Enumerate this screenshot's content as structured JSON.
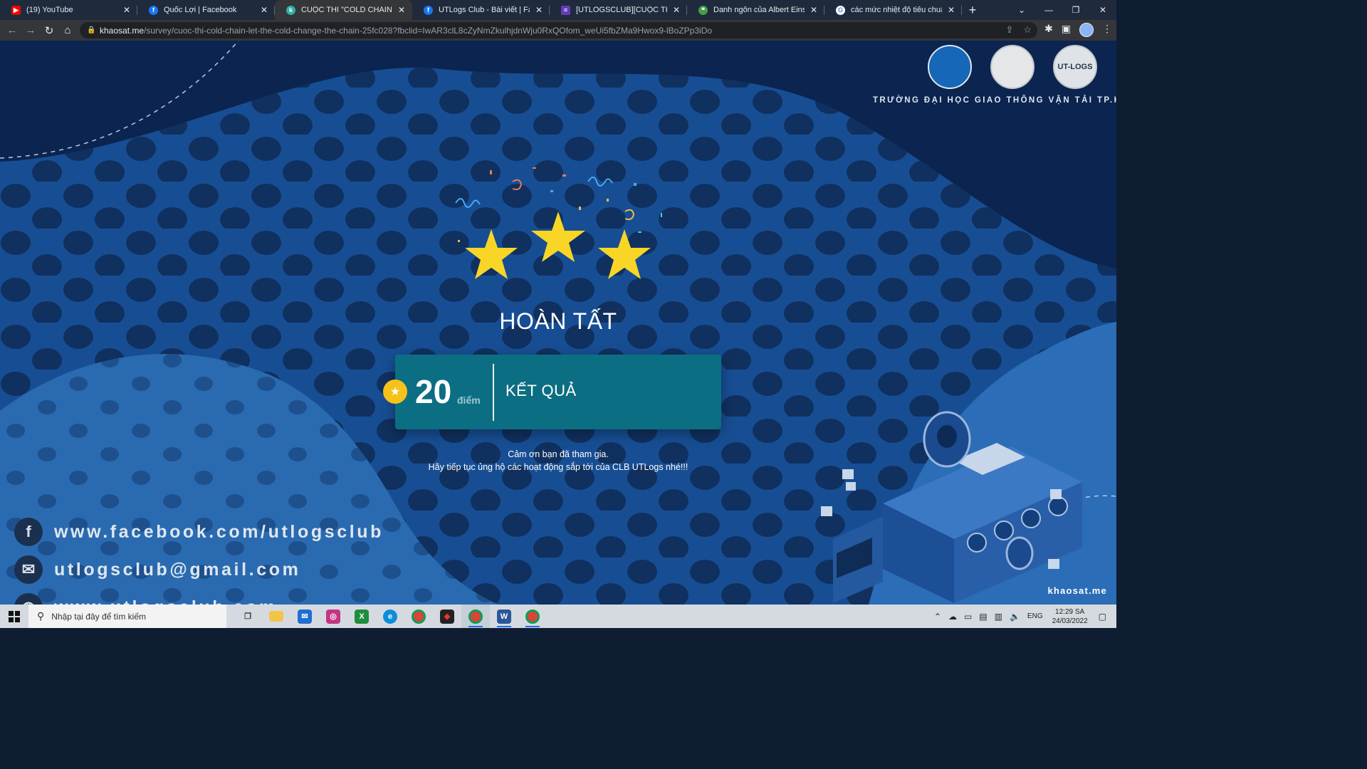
{
  "browser": {
    "tabs": [
      {
        "title": "(19) YouTube",
        "favicon": "youtube-icon",
        "color": "#ff0000",
        "active": false
      },
      {
        "title": "Quốc Lợi | Facebook",
        "favicon": "facebook-icon",
        "color": "#1877f2",
        "active": false
      },
      {
        "title": "CUỘC THI \"COLD CHAIN - LET THE",
        "favicon": "khaosat-icon",
        "color": "#2bb3a3",
        "active": true
      },
      {
        "title": "UTLogs Club - Bài viết | Facebook",
        "favicon": "facebook-icon",
        "color": "#1877f2",
        "active": false
      },
      {
        "title": "[UTLOGSCLUB][CUỘC THI \"COLD",
        "favicon": "forms-icon",
        "color": "#673ab7",
        "active": false
      },
      {
        "title": "Danh ngôn của Albert Einstein",
        "favicon": "quote-site-icon",
        "color": "#43a047",
        "active": false
      },
      {
        "title": "các mức nhiệt độ tiêu chuẩn phổ",
        "favicon": "google-icon",
        "color": "#4285f4",
        "active": false
      }
    ],
    "url_host": "khaosat.me",
    "url_path": "/survey/cuoc-thi-cold-chain-let-the-cold-change-the-chain-25fc028?fbclid=IwAR3clL8cZyNmZkulhjdnWju0RxQOfom_weUi5fbZMa9Hwox9-lBoZPp3iDo"
  },
  "page": {
    "logos": [
      "Hội Sinh Viên Việt Nam",
      "Khoa Kinh tế vận tải",
      "UT-LOGS"
    ],
    "logo_texts": [
      "",
      "",
      "UT-LOGS"
    ],
    "school_name": "TRƯỜNG ĐẠI HỌC GIAO THÔNG VẬN TẢI TP.HCM",
    "completion_title": "HOÀN TẤT",
    "stars": 3,
    "score": "20",
    "score_unit": "điểm",
    "result_label": "KẾT QUẢ",
    "thanks_line1": "Cảm ơn bạn đã tham gia.",
    "thanks_line2": "Hãy tiếp tục ủng hộ các hoạt động sắp tới của CLB UTLogs nhé!!!",
    "contacts": [
      {
        "icon": "facebook-icon",
        "text": "www.facebook.com/utlogsclub"
      },
      {
        "icon": "mail-icon",
        "text": "utlogsclub@gmail.com"
      },
      {
        "icon": "globe-icon",
        "text": "www.utlogsclub.com"
      }
    ],
    "watermark": "khaosat.me",
    "colors": {
      "card": "#0c6e82",
      "star": "#f9d525",
      "background": "#0d2a57"
    }
  },
  "taskbar": {
    "search_placeholder": "Nhập tại đây để tìm kiếm",
    "apps": [
      "task-view-icon",
      "file-explorer-icon",
      "mail-icon",
      "instagram-icon",
      "xbox-icon",
      "edge-icon",
      "chrome-icon",
      "game-icon",
      "chrome-icon",
      "word-icon",
      "chrome-icon"
    ],
    "language": "ENG",
    "time": "12:29 SA",
    "date": "24/03/2022"
  }
}
